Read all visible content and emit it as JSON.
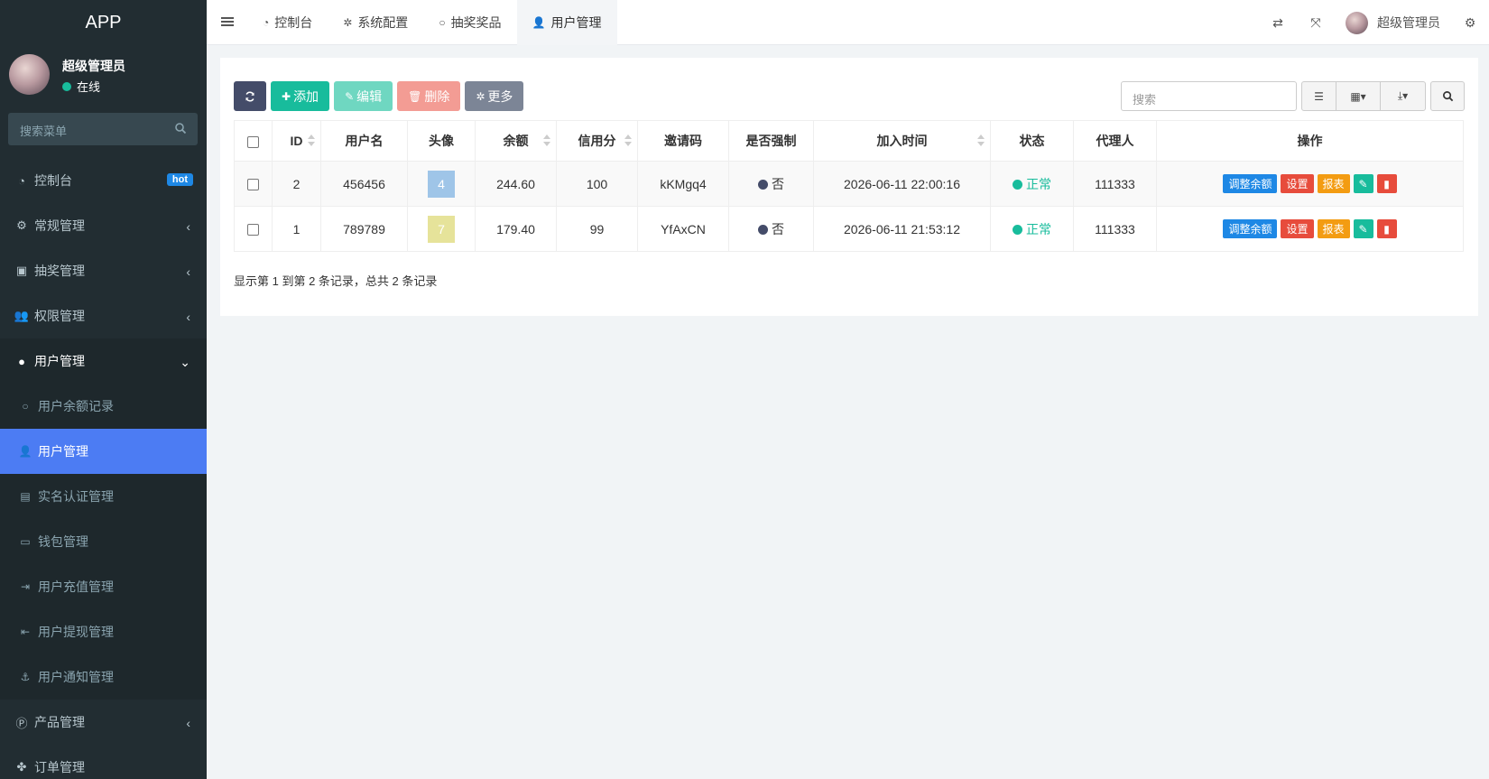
{
  "app": {
    "title": "APP"
  },
  "sidebar": {
    "user": {
      "name": "超级管理员",
      "status": "在线"
    },
    "search_placeholder": "搜索菜单",
    "items": [
      {
        "label": "控制台",
        "icon": "dashboard-icon",
        "badge": "hot"
      },
      {
        "label": "常规管理",
        "icon": "cogs-icon"
      },
      {
        "label": "抽奖管理",
        "icon": "gift-icon"
      },
      {
        "label": "权限管理",
        "icon": "group-icon"
      },
      {
        "label": "用户管理",
        "icon": "user-circle-icon",
        "expanded": true
      }
    ],
    "subitems": [
      {
        "label": "用户余额记录",
        "icon": "circle-o-icon"
      },
      {
        "label": "用户管理",
        "icon": "user-icon",
        "active": true
      },
      {
        "label": "实名认证管理",
        "icon": "id-card-icon"
      },
      {
        "label": "钱包管理",
        "icon": "money-icon"
      },
      {
        "label": "用户充值管理",
        "icon": "sign-in-icon"
      },
      {
        "label": "用户提现管理",
        "icon": "sign-out-icon"
      },
      {
        "label": "用户通知管理",
        "icon": "anchor-icon"
      }
    ],
    "items_after": [
      {
        "label": "产品管理",
        "icon": "product-icon"
      },
      {
        "label": "订单管理",
        "icon": "order-icon"
      }
    ]
  },
  "topnav": {
    "tabs": [
      {
        "label": "控制台",
        "icon": "dashboard-icon"
      },
      {
        "label": "系统配置",
        "icon": "gear-icon"
      },
      {
        "label": "抽奖奖品",
        "icon": "circle-o-icon"
      },
      {
        "label": "用户管理",
        "icon": "user-icon",
        "active": true
      }
    ],
    "user_name": "超级管理员"
  },
  "toolbar": {
    "add_label": "添加",
    "edit_label": "编辑",
    "delete_label": "删除",
    "more_label": "更多",
    "search_placeholder": "搜索"
  },
  "table": {
    "headers": [
      "ID",
      "用户名",
      "头像",
      "余额",
      "信用分",
      "邀请码",
      "是否强制",
      "加入时间",
      "状态",
      "代理人",
      "操作"
    ],
    "rows": [
      {
        "id": "2",
        "username": "456456",
        "avatar": "4",
        "avatar_color": "#9fc5e8",
        "balance": "244.60",
        "credit": "100",
        "invite": "kKMgq4",
        "forced": "否",
        "joined": "2026-06-11 22:00:16",
        "status": "正常",
        "agent": "111333"
      },
      {
        "id": "1",
        "username": "789789",
        "avatar": "7",
        "avatar_color": "#e6e39a",
        "balance": "179.40",
        "credit": "99",
        "invite": "YfAxCN",
        "forced": "否",
        "joined": "2026-06-11 21:53:12",
        "status": "正常",
        "agent": "111333"
      }
    ],
    "ops": {
      "adjust": "调整余额",
      "settings": "设置",
      "report": "报表"
    }
  },
  "pagination": {
    "summary": "显示第 1 到第 2 条记录，总共 2 条记录"
  },
  "colors": {
    "sidebar_bg": "#222d32",
    "active": "#4c7cf3",
    "success": "#18bc9c",
    "danger": "#e74c3c",
    "warning": "#f39c12",
    "primary": "#1e88e5"
  }
}
